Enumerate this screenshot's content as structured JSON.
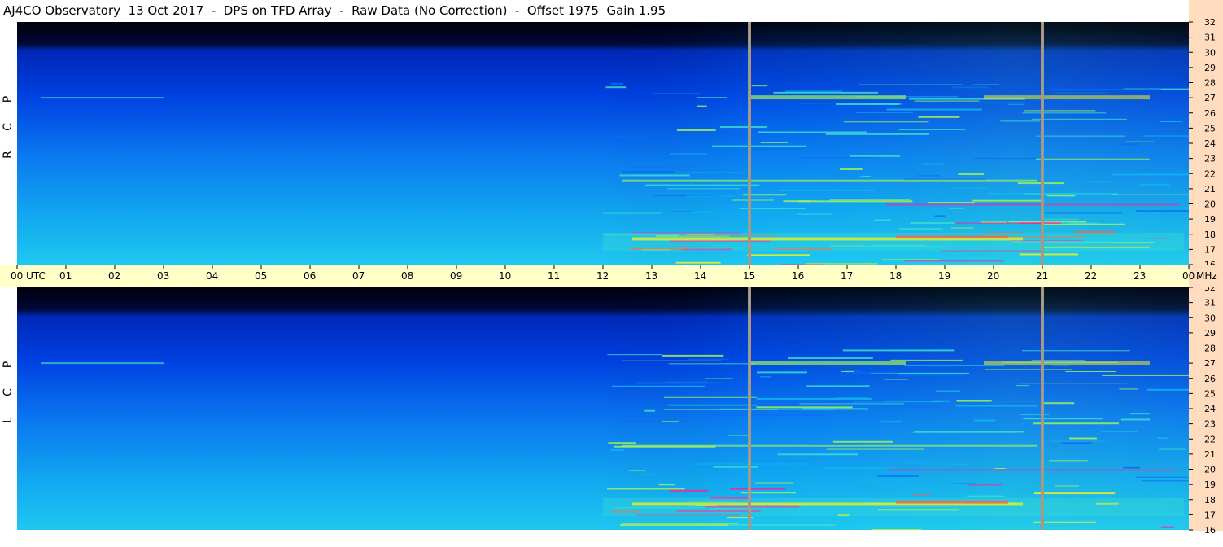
{
  "title": "AJ4CO Observatory  13 Oct 2017  -  DPS on TFD Array  -  Raw Data (No Correction)  -  Offset 1975  Gain 1.95",
  "colors": {
    "time_axis_bg": "#ffffc8",
    "freq_axis_bg": "#ffdcbe",
    "vertical_marker": "#b88a8a",
    "background": "#ffffff"
  },
  "panels": [
    {
      "id": "rcp",
      "label_letters": [
        "R",
        "C",
        "P"
      ]
    },
    {
      "id": "lcp",
      "label_letters": [
        "L",
        "C",
        "P"
      ]
    }
  ],
  "chart_data": {
    "type": "heatmap",
    "title": "AJ4CO Observatory  13 Oct 2017  -  DPS on TFD Array  -  Raw Data (No Correction)  -  Offset 1975  Gain 1.95",
    "x_tick_labels": [
      "00 UTC",
      "01",
      "02",
      "03",
      "04",
      "05",
      "06",
      "07",
      "08",
      "09",
      "10",
      "11",
      "12",
      "13",
      "14",
      "15",
      "16",
      "17",
      "18",
      "19",
      "20",
      "21",
      "22",
      "23",
      "00"
    ],
    "x_range_hours": [
      0,
      24
    ],
    "y_tick_labels": [
      "16",
      "17",
      "18",
      "19",
      "20",
      "21",
      "22",
      "23",
      "24",
      "25",
      "26",
      "27",
      "28",
      "29",
      "30",
      "31",
      "32"
    ],
    "y_range_mhz": [
      16,
      32
    ],
    "y_unit_label": "MHz",
    "marker_times_hours": [
      15.0,
      21.0
    ],
    "series": [
      {
        "name": "RCP"
      },
      {
        "name": "LCP"
      }
    ],
    "colormap": [
      "#000010",
      "#00106a",
      "#0030d0",
      "#0a70f0",
      "#14b4f0",
      "#3cdcd0",
      "#a0f060",
      "#f0f020",
      "#ff6040",
      "#ff20a0"
    ]
  }
}
